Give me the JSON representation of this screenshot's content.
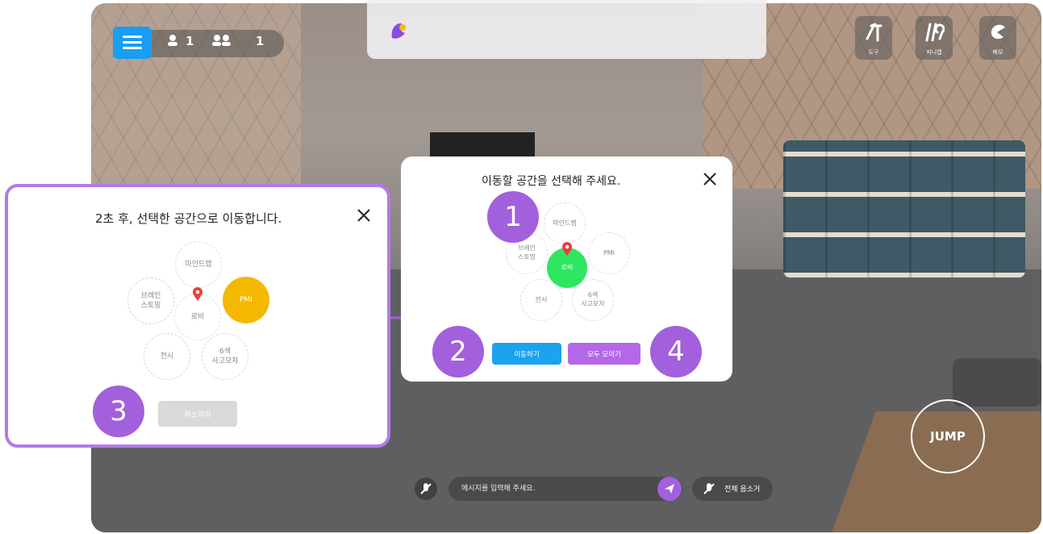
{
  "colors": {
    "accent_purple": "#a260dc",
    "move_button": "#1aa3ef",
    "gather_button": "#b468e8",
    "lobby_green": "#2ee65f",
    "pmi_yellow": "#f5b800",
    "menu_blue": "#1a9df4",
    "cancel_gray": "#d9d9d9"
  },
  "hud": {
    "count_a": "1",
    "count_b": "1",
    "tools": [
      {
        "label": "도구",
        "icon": "wrench-icon"
      },
      {
        "label": "미니맵",
        "icon": "minimap-icon"
      },
      {
        "label": "메모",
        "icon": "memo-icon"
      }
    ]
  },
  "dialog_select": {
    "title": "이동할 공간을 선택해 주세요.",
    "spaces": {
      "mindmap": "마인드맵",
      "brainstorm": "브레인\n스토밍",
      "lobby": "로비",
      "pmi": "PMI",
      "exhibit": "전시",
      "six_hats": "6색\n사고모자"
    },
    "move_button": "이동하기",
    "gather_button": "모두 모이기"
  },
  "dialog_countdown": {
    "title": "2초 후, 선택한 공간으로 이동합니다.",
    "spaces": {
      "mindmap": "마인드맵",
      "brainstorm": "브레인\n스토밍",
      "lobby": "로비",
      "pmi": "PMI",
      "exhibit": "전시",
      "six_hats": "6색\n사고모자"
    },
    "cancel_button": "취소하기"
  },
  "badges": [
    "1",
    "2",
    "3",
    "4"
  ],
  "chat": {
    "placeholder": "메시지를 입력해 주세요.",
    "mute_all": "전체 음소거"
  },
  "jump_label": "JUMP"
}
